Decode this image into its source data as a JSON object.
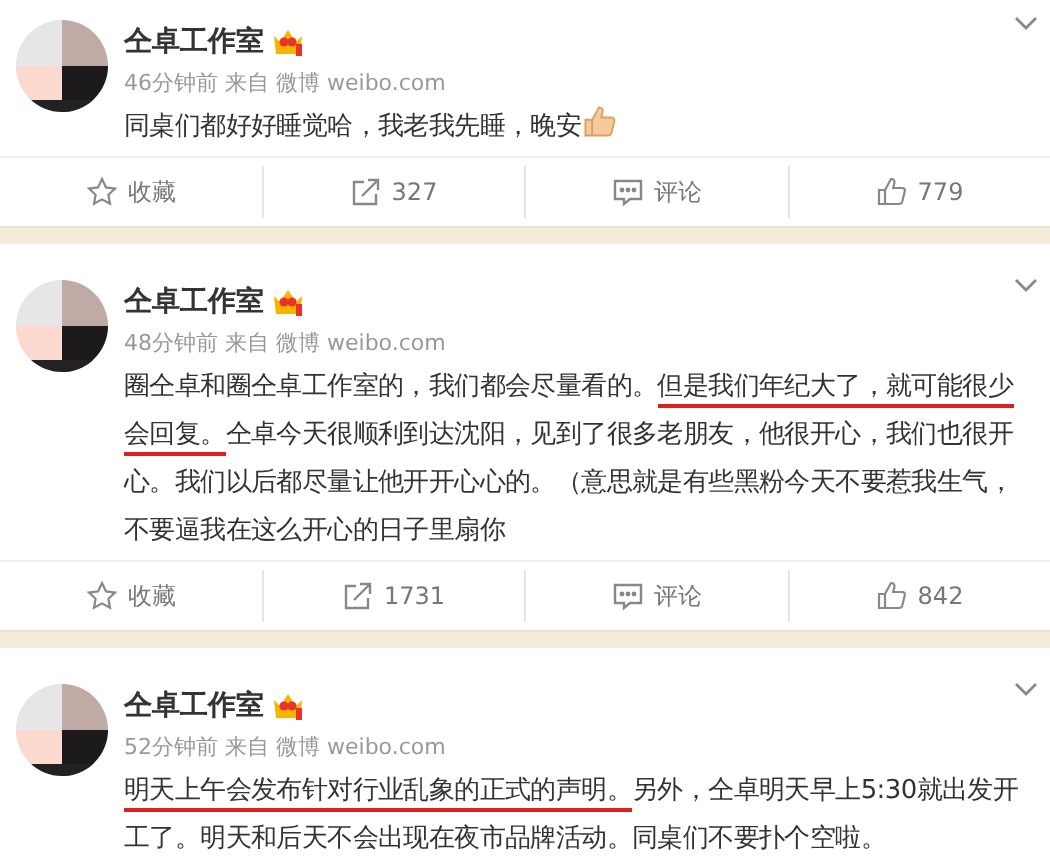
{
  "posts": [
    {
      "author": "仝卓工作室",
      "time": "46分钟前",
      "source_label": "来自",
      "source": "微博 weibo.com",
      "segments": [
        {
          "text": "同桌们都好好睡觉哈，我老我先睡，晚安",
          "underlined": false
        }
      ],
      "has_emoji": true,
      "actions": [
        {
          "kind": "favorite",
          "label": "收藏"
        },
        {
          "kind": "share",
          "label": "327"
        },
        {
          "kind": "comment",
          "label": "评论"
        },
        {
          "kind": "like",
          "label": "779"
        }
      ]
    },
    {
      "author": "仝卓工作室",
      "time": "48分钟前",
      "source_label": "来自",
      "source": "微博 weibo.com",
      "segments": [
        {
          "text": "圈仝卓和圈仝卓工作室的，我们都会尽量看的。",
          "underlined": false
        },
        {
          "text": "但是我们年纪大了，就可能很少会回复。",
          "underlined": true
        },
        {
          "text": "仝卓今天很顺利到达沈阳，见到了很多老朋友，他很开心，我们也很开心。我们以后都尽量让他开开心心的。（意思就是有些黑粉今天不要惹我生气，不要逼我在这么开心的日子里扇你",
          "underlined": false
        }
      ],
      "actions": [
        {
          "kind": "favorite",
          "label": "收藏"
        },
        {
          "kind": "share",
          "label": "1731"
        },
        {
          "kind": "comment",
          "label": "评论"
        },
        {
          "kind": "like",
          "label": "842"
        }
      ]
    },
    {
      "author": "仝卓工作室",
      "time": "52分钟前",
      "source_label": "来自",
      "source": "微博 weibo.com",
      "segments": [
        {
          "text": "明天上午会发布针对行业乱象的正式的声明。",
          "underlined": true
        },
        {
          "text": "另外，仝卓明天早上5:30就出发开工了。明天和后天不会出现在夜市品牌活动。同桌们不要扑个空啦。",
          "underlined": false
        }
      ]
    }
  ]
}
